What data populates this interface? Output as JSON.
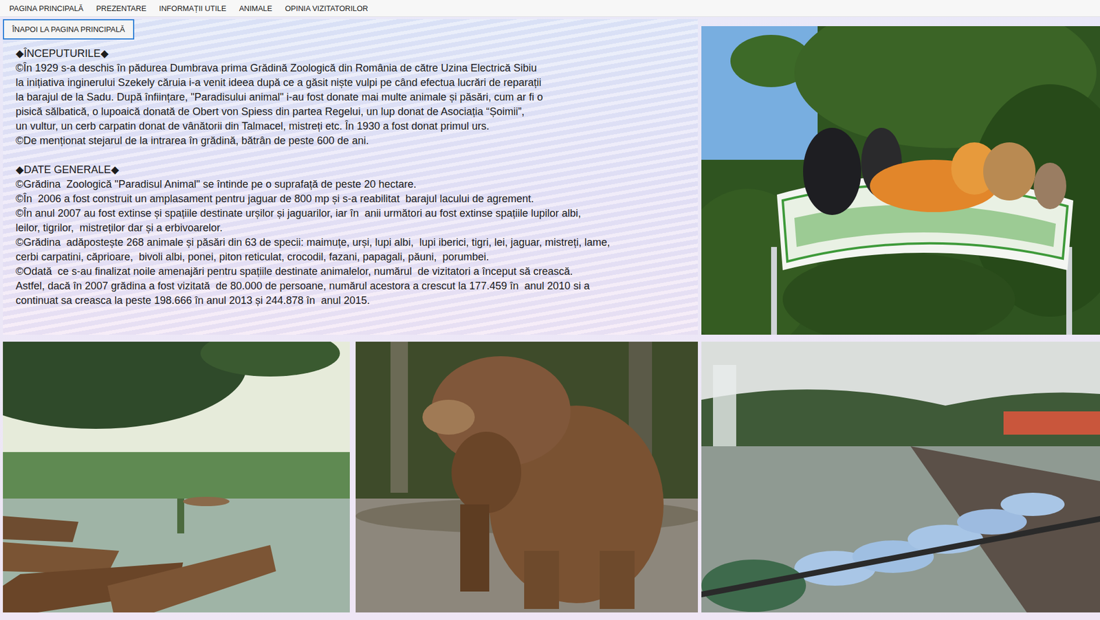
{
  "menu": [
    {
      "label": "PAGINA PRINCIPALĂ"
    },
    {
      "label": "PREZENTARE"
    },
    {
      "label": "INFORMAȚII UTILE"
    },
    {
      "label": "ANIMALE"
    },
    {
      "label": "OPINIA VIZITATORILOR"
    }
  ],
  "back_button": "ÎNAPOI LA PAGINA PRINCIPALĂ",
  "sections": [
    {
      "heading": "◆ÎNCEPUTURILE◆",
      "lines": [
        "©În 1929 s-a deschis în pădurea Dumbrava prima Grădină Zoologică din România de către Uzina Electrică Sibiu",
        "la inițiativa inginerului Szekely căruia i-a venit ideea după ce a găsit niște vulpi pe când efectua lucrări de reparații",
        "la barajul de la Sadu. După înființare, \"Paradisului animal\" i-au fost donate mai multe animale și păsări, cum ar fi o",
        "pisică sălbatică, o lupoaică donată de Obert von Spiess din partea Regelui, un lup donat de Asociația “Șoimii”,",
        "un vultur, un cerb carpatin donat de vânătorii din Talmacel, mistreți etc. În 1930 a fost donat primul urs.",
        "©De menționat stejarul de la intrarea în grădină, bătrân de peste 600 de ani."
      ]
    },
    {
      "heading": "◆DATE GENERALE◆",
      "lines": [
        "©Grădina  Zoologică \"Paradisul Animal\" se întinde pe o suprafață de peste 20 hectare.",
        "©În  2006 a fost construit un amplasament pentru jaguar de 800 mp și s-a reabilitat  barajul lacului de agrement.",
        "©În anul 2007 au fost extinse și spațiile destinate urșilor și jaguarilor, iar în  anii următori au fost extinse spațiile lupilor albi,",
        "leilor, tigrilor,  mistreților dar și a erbivoarelor.",
        "©Grădina  adăpostește 268 animale și păsări din 63 de specii: maimuțe, urși, lupi albi,  lupi iberici, tigri, lei, jaguar, mistreți, lame,",
        "cerbi carpatini, căprioare,  bivoli albi, ponei, piton reticulat, crocodil, fazani, papagali, păuni,  porumbei.",
        "©Odată  ce s-au finalizat noile amenajări pentru spațiile destinate animalelor, numărul  de vizitatori a început să crească.",
        "Astfel, dacă în 2007 grădina a fost vizitată  de 80.000 de persoane, numărul acestora a crescut la 177.459 în  anul 2010 si a",
        "continuat sa creasca la peste 198.666 în anul 2013 și 244.878 în  anul 2015."
      ]
    }
  ]
}
